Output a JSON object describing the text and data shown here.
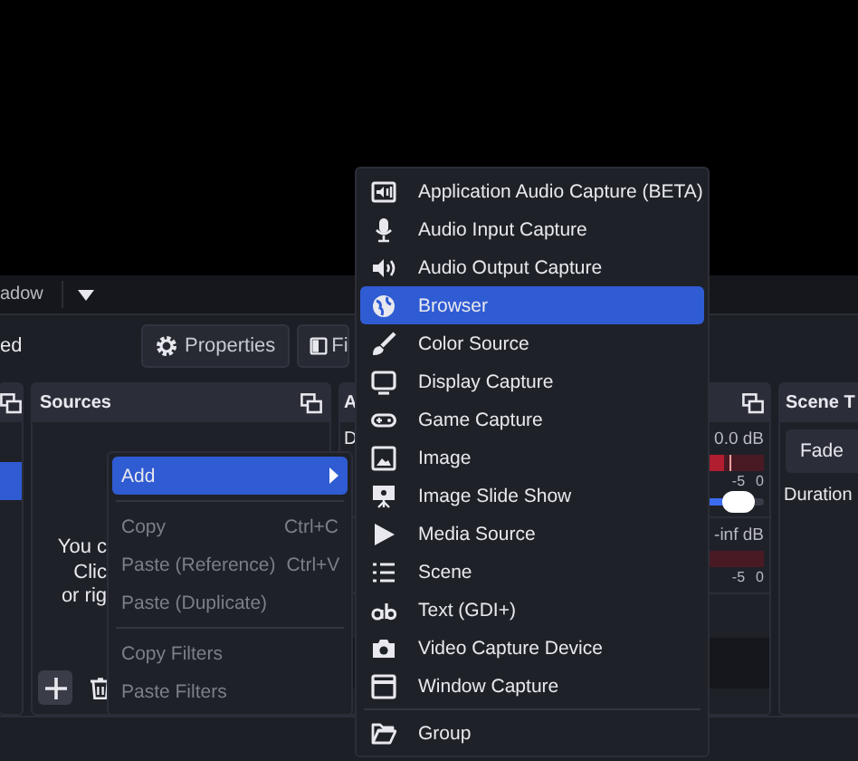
{
  "mode_dropdown": {
    "value": "adow"
  },
  "controls": {
    "label": "ed",
    "buttons": [
      {
        "label": "Properties"
      },
      {
        "label": "Fi"
      }
    ]
  },
  "scenes_dock": {
    "items": [
      {
        "selected": true
      }
    ]
  },
  "sources_dock": {
    "title": "Sources",
    "hint_lines": [
      "You c",
      "Clic",
      "or rig"
    ]
  },
  "audio_mixer": {
    "title": "A",
    "channels": [
      {
        "name": "D",
        "reading": "0.0 dB",
        "level": 0.9,
        "volume": {
          "level": 0.95
        },
        "scale": [
          "-5",
          "0"
        ]
      },
      {
        "reading": "-inf dB",
        "scale": [
          "-5",
          "0"
        ]
      }
    ]
  },
  "scene_transitions": {
    "title": "Scene T",
    "transition": "Fade",
    "duration_label": "Duration"
  },
  "context_menu": {
    "items": [
      {
        "kind": "item",
        "label": "Add",
        "disabled": false,
        "selected": true,
        "submenu": true
      },
      {
        "kind": "separator"
      },
      {
        "kind": "item",
        "label": "Copy",
        "shortcut": "Ctrl+C",
        "disabled": true,
        "selected": false,
        "submenu": false
      },
      {
        "kind": "item",
        "label": "Paste (Reference)",
        "shortcut": "Ctrl+V",
        "disabled": true,
        "selected": false,
        "submenu": false
      },
      {
        "kind": "item",
        "label": "Paste (Duplicate)",
        "disabled": true,
        "selected": false,
        "submenu": false
      },
      {
        "kind": "separator"
      },
      {
        "kind": "item",
        "label": "Copy Filters",
        "disabled": true,
        "selected": false,
        "submenu": false
      },
      {
        "kind": "item",
        "label": "Paste Filters",
        "disabled": true,
        "selected": false,
        "submenu": false
      }
    ]
  },
  "add_submenu": {
    "items": [
      {
        "kind": "item",
        "label": "Application Audio Capture (BETA)",
        "selected": false
      },
      {
        "kind": "item",
        "label": "Audio Input Capture",
        "selected": false
      },
      {
        "kind": "item",
        "label": "Audio Output Capture",
        "selected": false
      },
      {
        "kind": "item",
        "label": "Browser",
        "selected": true
      },
      {
        "kind": "item",
        "label": "Color Source",
        "selected": false
      },
      {
        "kind": "item",
        "label": "Display Capture",
        "selected": false
      },
      {
        "kind": "item",
        "label": "Game Capture",
        "selected": false
      },
      {
        "kind": "item",
        "label": "Image",
        "selected": false
      },
      {
        "kind": "item",
        "label": "Image Slide Show",
        "selected": false
      },
      {
        "kind": "item",
        "label": "Media Source",
        "selected": false
      },
      {
        "kind": "item",
        "label": "Scene",
        "selected": false
      },
      {
        "kind": "item",
        "label": "Text (GDI+)",
        "selected": false
      },
      {
        "kind": "item",
        "label": "Video Capture Device",
        "selected": false
      },
      {
        "kind": "item",
        "label": "Window Capture",
        "selected": false
      },
      {
        "kind": "separator"
      },
      {
        "kind": "item",
        "label": "Group",
        "selected": false
      }
    ]
  }
}
